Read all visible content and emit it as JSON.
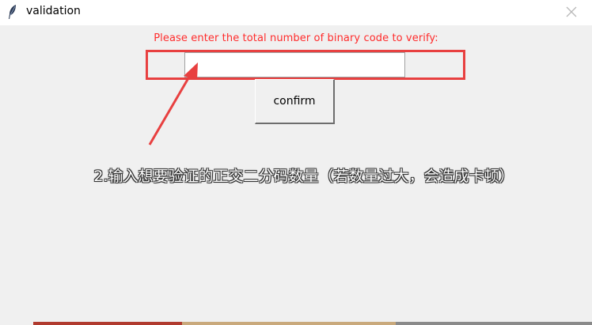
{
  "window": {
    "title": "validation",
    "close_symbol": "✕"
  },
  "form": {
    "prompt": "Please enter the total number of binary code to verify:",
    "input_value": "",
    "confirm_label": "confirm"
  },
  "annotation": {
    "text": "2.输入想要验证的正交二分码数量（若数量过大，会造成卡顿）"
  },
  "colors": {
    "prompt_text": "#ff2b2b",
    "highlight_box": "#e84040",
    "arrow": "#e84040"
  },
  "icons": {
    "app": "feather-icon",
    "close": "close-icon",
    "arrow": "arrow-icon"
  }
}
